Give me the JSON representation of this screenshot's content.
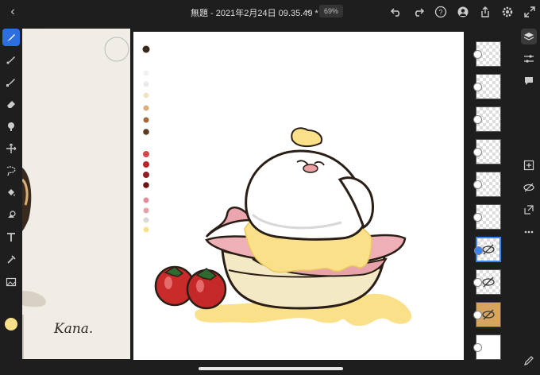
{
  "document": {
    "title": "無題 - 2021年2月24日 09.35.49 *",
    "zoom": "69%"
  },
  "brush": {
    "size": "32",
    "color": "#fbe08a"
  },
  "signature": "Kana.",
  "icons": {
    "top": [
      "back-icon",
      "undo-icon",
      "redo-icon",
      "help-icon",
      "profile-icon",
      "share-icon",
      "settings-icon",
      "fullscreen-icon"
    ],
    "tools": [
      "pixel-brush-icon",
      "live-brush-icon",
      "vector-brush-icon",
      "eraser-icon",
      "smudge-icon",
      "move-icon",
      "selection-icon",
      "fill-icon",
      "shape-icon",
      "text-icon",
      "eyedropper-icon",
      "image-icon"
    ],
    "right": [
      "layers-icon",
      "layer-properties-icon",
      "comments-icon",
      "add-layer-icon",
      "visibility-icon",
      "export-layer-icon",
      "more-icon"
    ]
  },
  "colors": {
    "accent": "#2d6fe0",
    "swatches": [
      "#3a2a1e",
      "#f2f2f2",
      "#ebebeb",
      "#f3e3c3",
      "#d9b07a",
      "#a4683a",
      "#5a3a22",
      "#d94848",
      "#b8262a",
      "#8e1e22",
      "#6e1216",
      "#e08f9a",
      "#e6a0a8",
      "#d8d8d8",
      "#fbe08a"
    ]
  },
  "layers": [
    {
      "name": "layer-1",
      "type": "checker",
      "hidden": false,
      "selected": false
    },
    {
      "name": "layer-2",
      "type": "checker",
      "hidden": false,
      "selected": false
    },
    {
      "name": "layer-3",
      "type": "checker",
      "hidden": false,
      "selected": false
    },
    {
      "name": "layer-4",
      "type": "checker",
      "hidden": false,
      "selected": false
    },
    {
      "name": "layer-5",
      "type": "checker",
      "hidden": false,
      "selected": false
    },
    {
      "name": "layer-6",
      "type": "checker",
      "hidden": false,
      "selected": false
    },
    {
      "name": "layer-7",
      "type": "checker",
      "hidden": true,
      "selected": true
    },
    {
      "name": "layer-8",
      "type": "checker",
      "hidden": true,
      "selected": false
    },
    {
      "name": "layer-9",
      "type": "tan",
      "hidden": true,
      "selected": false
    },
    {
      "name": "layer-10",
      "type": "white",
      "hidden": false,
      "selected": false
    }
  ]
}
